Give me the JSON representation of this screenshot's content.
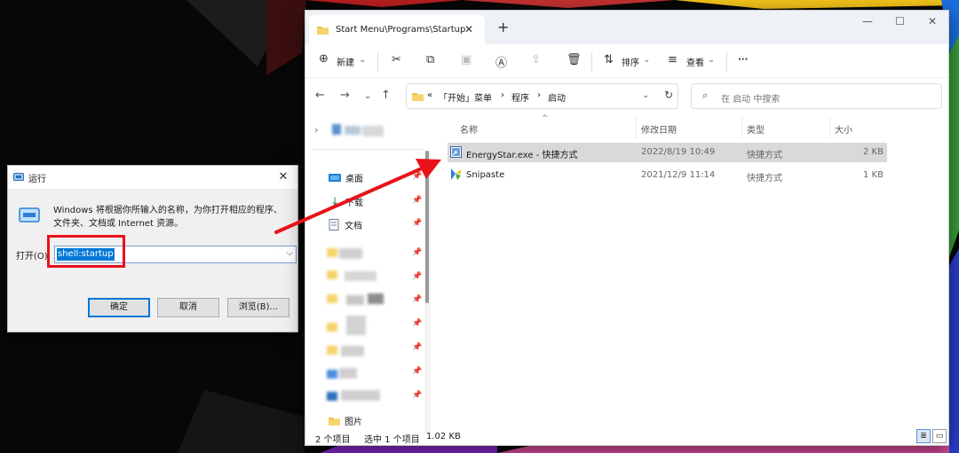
{
  "run": {
    "title": "运行",
    "desc": "Windows 将根据你所输入的名称，为你打开相应的程序、文件夹、文档或 Internet 资源。",
    "open_label": "打开(O):",
    "input_value": "shell:startup",
    "ok": "确定",
    "cancel": "取消",
    "browse": "浏览(B)..."
  },
  "explorer": {
    "tab_title": "Start Menu\\Programs\\Startup",
    "toolbar": {
      "new": "新建",
      "sort": "排序",
      "view": "查看",
      "more": "···"
    },
    "breadcrumb": [
      "「开始」菜单",
      "程序",
      "启动"
    ],
    "search_placeholder": "在 启动 中搜索",
    "nav_items": [
      {
        "label": "桌面",
        "icon": "desktop-icon"
      },
      {
        "label": "下载",
        "icon": "download-icon"
      },
      {
        "label": "文档",
        "icon": "document-icon"
      },
      {
        "label": "图片",
        "icon": "picture-icon"
      }
    ],
    "columns": [
      "名称",
      "修改日期",
      "类型",
      "大小"
    ],
    "files": [
      {
        "name": "EnergyStar.exe - 快捷方式",
        "date": "2022/8/19 10:49",
        "type": "快捷方式",
        "size": "2 KB",
        "icon": "shortcut-icon",
        "selected": true
      },
      {
        "name": "Snipaste",
        "date": "2021/12/9 11:14",
        "type": "快捷方式",
        "size": "1 KB",
        "icon": "snipaste-icon",
        "selected": false
      }
    ],
    "status": {
      "count": "2 个项目",
      "selection": "选中 1 个项目",
      "size": "1.02 KB"
    }
  },
  "colors": {
    "highlight": "#e8121a",
    "accent": "#0078d7",
    "folder": "#f2c04b"
  }
}
